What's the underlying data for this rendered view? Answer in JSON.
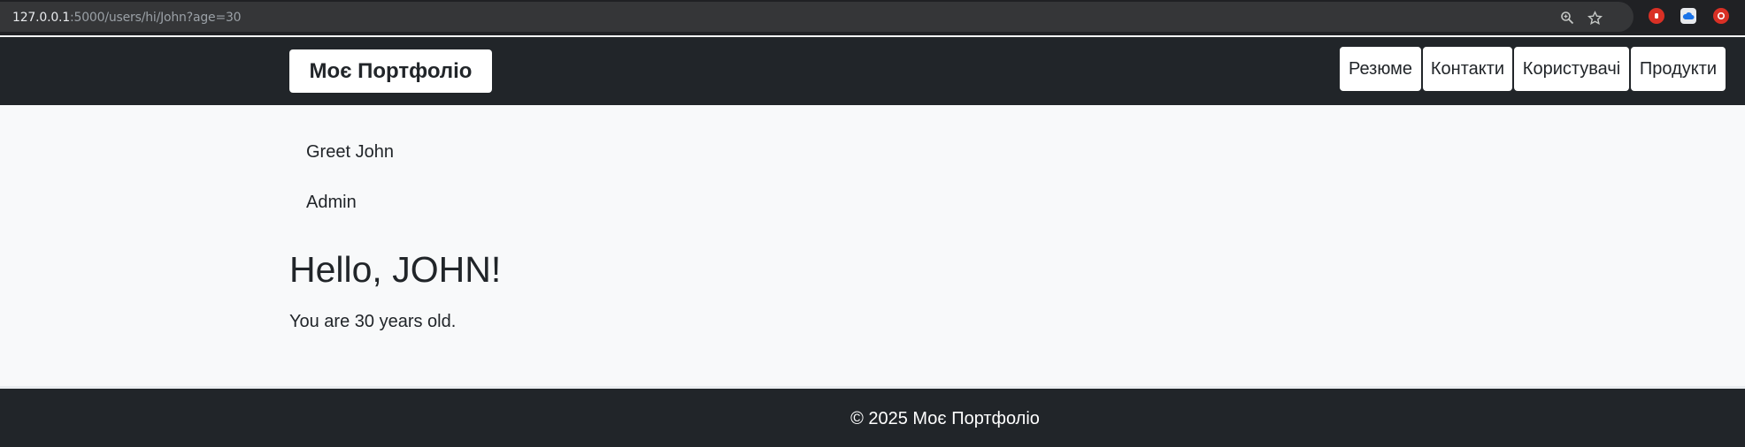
{
  "browser": {
    "url_host": "127.0.0.1",
    "url_rest": ":5000/users/hi/John?age=30",
    "icons": [
      "zoom-icon",
      "star-icon",
      "extension-icon"
    ]
  },
  "navbar": {
    "brand": "Моє Портфоліо",
    "links": [
      {
        "label": "Резюме"
      },
      {
        "label": "Контакти"
      },
      {
        "label": "Користувачі"
      },
      {
        "label": "Продукти"
      }
    ]
  },
  "main": {
    "side_links": [
      {
        "label": "Greet John"
      },
      {
        "label": "Admin"
      }
    ],
    "heading": "Hello, JOHN!",
    "age_text": "You are 30 years old."
  },
  "footer": {
    "text": "© 2025 Моє Портфоліо"
  },
  "colors": {
    "navbar_bg": "#212529",
    "page_bg": "#f8f9fa",
    "text": "#212529"
  }
}
